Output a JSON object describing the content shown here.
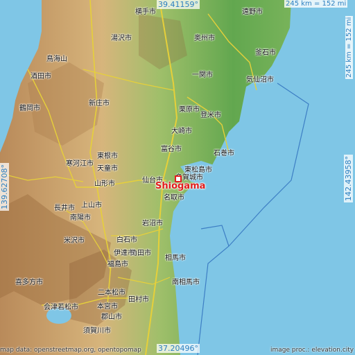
{
  "map": {
    "place": "Shiogama",
    "coords": {
      "north": "39.41159°",
      "south": "37.20496°",
      "west": "139.62708°",
      "east": "142.43958°"
    },
    "scale": {
      "horizontal": "245 km = 152 mi",
      "vertical": "245 km = 152 mi"
    },
    "credits": {
      "left": "map data: openstreetmap.org, opentopomap",
      "right": "image proc.: elevation.city"
    },
    "labels": {
      "yokote": "横手市",
      "tono": "遠野市",
      "oshu": "奥州市",
      "yuzawa": "湯沢市",
      "chokaisan": "鳥海山",
      "kamaishi": "釜石市",
      "sakata": "酒田市",
      "ichinoseki": "一関市",
      "kesennuma": "気仙沼市",
      "tsuruoka": "鶴岡市",
      "shinjo": "新庄市",
      "kurihara": "栗原市",
      "tome": "登米市",
      "osaki": "大崎市",
      "higashine": "東根市",
      "tomiya": "富谷市",
      "ishinomaki": "石巻市",
      "sagae": "寒河江市",
      "tendo": "天童市",
      "higashimatsushima": "東松島市",
      "sendai": "仙台市",
      "tagajo": "多賀城市",
      "yamagata": "山形市",
      "natori": "名取市",
      "nagai": "長井市",
      "nanyo": "南陽市",
      "iwanuma": "岩沼市",
      "kaminoyama": "上山市",
      "yonezawa": "米沢市",
      "shiroishi": "白石市",
      "kakuda": "角田市",
      "date": "伊達市",
      "soma": "相馬市",
      "fukushima": "福島市",
      "kitakata": "喜多方市",
      "nihonmatsu": "二本松市",
      "minamisoma": "南相馬市",
      "aizuwakamatsu": "会津若松市",
      "koriyama": "郡山市",
      "tamura": "田村市",
      "motomiya": "本宮市",
      "sukagawa": "須賀川市"
    }
  }
}
